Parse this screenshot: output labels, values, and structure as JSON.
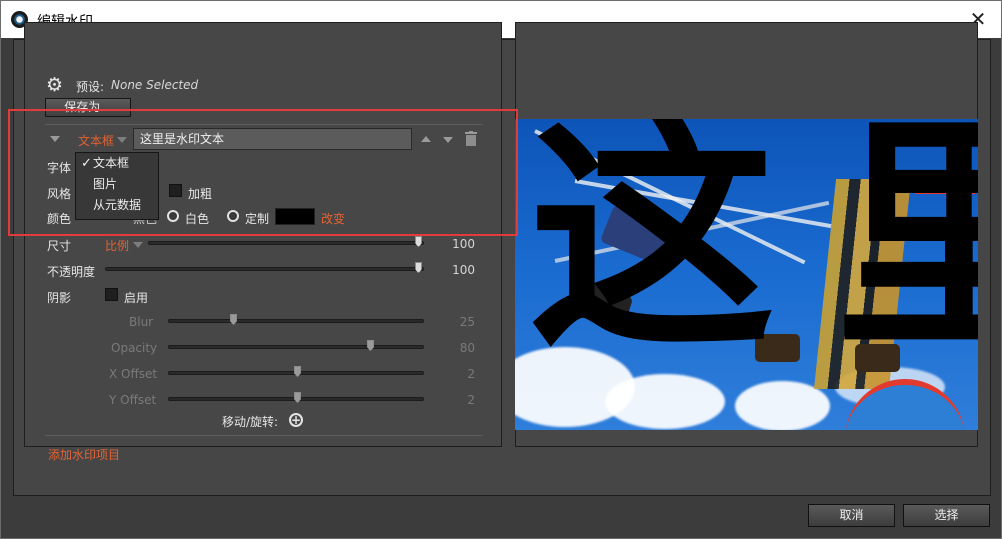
{
  "window": {
    "title": "编辑水印",
    "close_glyph": "✕"
  },
  "preset": {
    "label": "预设:",
    "value": "None Selected",
    "save_as_label": "保存为..."
  },
  "watermark_item": {
    "type_selected": "文本框",
    "text_value": "这里是水印文本",
    "type_options": [
      "文本框",
      "图片",
      "从元数据"
    ],
    "icons": [
      "collapse-arrow-icon",
      "move-up-icon",
      "move-down-icon",
      "trash-icon"
    ]
  },
  "font": {
    "label": "字体"
  },
  "style": {
    "label": "风格",
    "bold_label": "加粗"
  },
  "color": {
    "label": "颜色",
    "black_option_fragment": "黑色",
    "white_option": "白色",
    "custom_option": "定制",
    "custom_swatch_color": "#000000",
    "change_link": "改变"
  },
  "size": {
    "label": "尺寸",
    "mode": "比例",
    "value": "100"
  },
  "opacity": {
    "label": "不透明度",
    "value": "100"
  },
  "shadow": {
    "label": "阴影",
    "enable_label": "启用",
    "blur_label": "Blur",
    "blur_value": "25",
    "opacity_label": "Opacity",
    "opacity_value": "80",
    "x_offset_label": "X Offset",
    "x_offset_value": "2",
    "y_offset_label": "Y Offset",
    "y_offset_value": "2"
  },
  "move_rotate": {
    "label": "移动/旋转:"
  },
  "add_item_link": "添加水印项目",
  "preview": {
    "watermark_chars": [
      "这",
      "里"
    ],
    "accent_color": "#e36233"
  },
  "footer": {
    "cancel_label": "取消",
    "select_label": "选择"
  }
}
